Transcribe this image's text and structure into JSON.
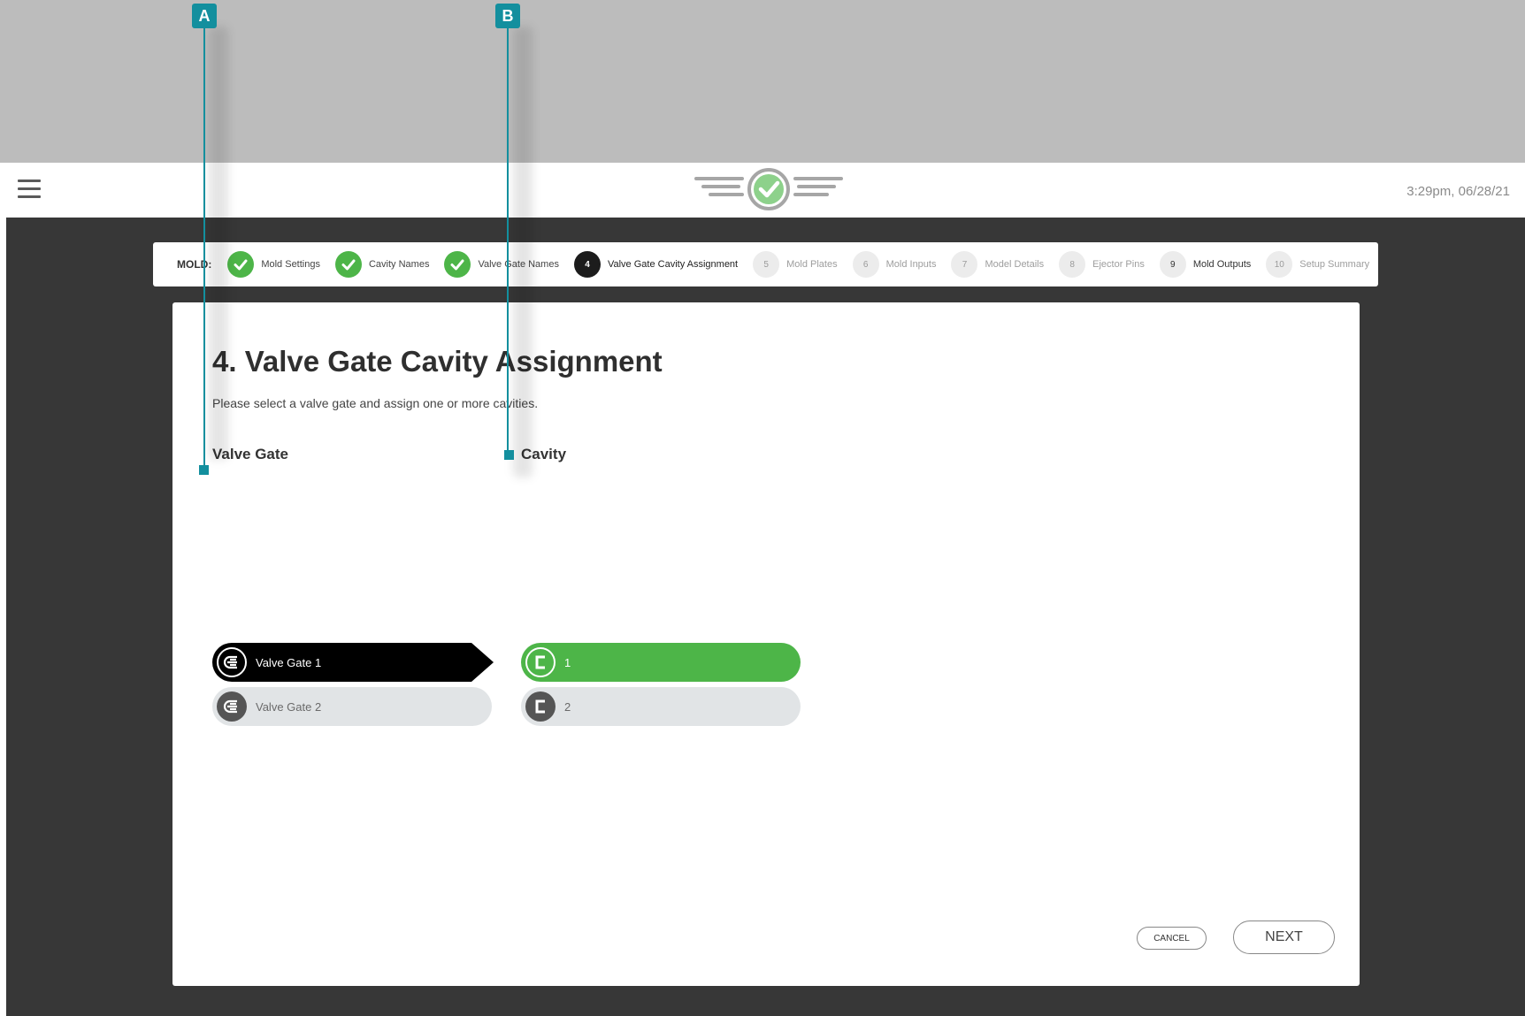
{
  "header": {
    "timestamp": "3:29pm, 06/28/21"
  },
  "steps_bar": {
    "label": "MOLD:",
    "steps": [
      {
        "number": "1",
        "label": "Mold Settings",
        "state": "complete"
      },
      {
        "number": "2",
        "label": "Cavity Names",
        "state": "complete"
      },
      {
        "number": "3",
        "label": "Valve Gate Names",
        "state": "complete"
      },
      {
        "number": "4",
        "label": "Valve Gate Cavity Assignment",
        "state": "current"
      },
      {
        "number": "5",
        "label": "Mold Plates",
        "state": "upcoming"
      },
      {
        "number": "6",
        "label": "Mold Inputs",
        "state": "upcoming"
      },
      {
        "number": "7",
        "label": "Model Details",
        "state": "upcoming"
      },
      {
        "number": "8",
        "label": "Ejector Pins",
        "state": "upcoming"
      },
      {
        "number": "9",
        "label": "Mold Outputs",
        "state": "upcoming"
      },
      {
        "number": "10",
        "label": "Setup Summary",
        "state": "upcoming"
      }
    ]
  },
  "main": {
    "title": "4. Valve Gate Cavity Assignment",
    "subtitle": "Please select a valve gate and assign one or more cavities.",
    "valve_gate_header": "Valve Gate",
    "cavity_header": "Cavity",
    "valve_gates": [
      {
        "label": "Valve Gate 1",
        "selected": true,
        "icon": "valve-gate-icon"
      },
      {
        "label": "Valve Gate 2",
        "selected": false,
        "icon": "valve-gate-icon"
      }
    ],
    "cavities": [
      {
        "label": "1",
        "assigned": true,
        "icon": "cavity-icon"
      },
      {
        "label": "2",
        "assigned": false,
        "icon": "cavity-icon"
      }
    ]
  },
  "buttons": {
    "cancel": "CANCEL",
    "next": "NEXT"
  },
  "callouts": {
    "a": "A",
    "b": "B"
  },
  "colors": {
    "accent_green": "#4db548",
    "callout_teal": "#138f9e",
    "app_background": "#373737",
    "selected_black": "#000000"
  }
}
